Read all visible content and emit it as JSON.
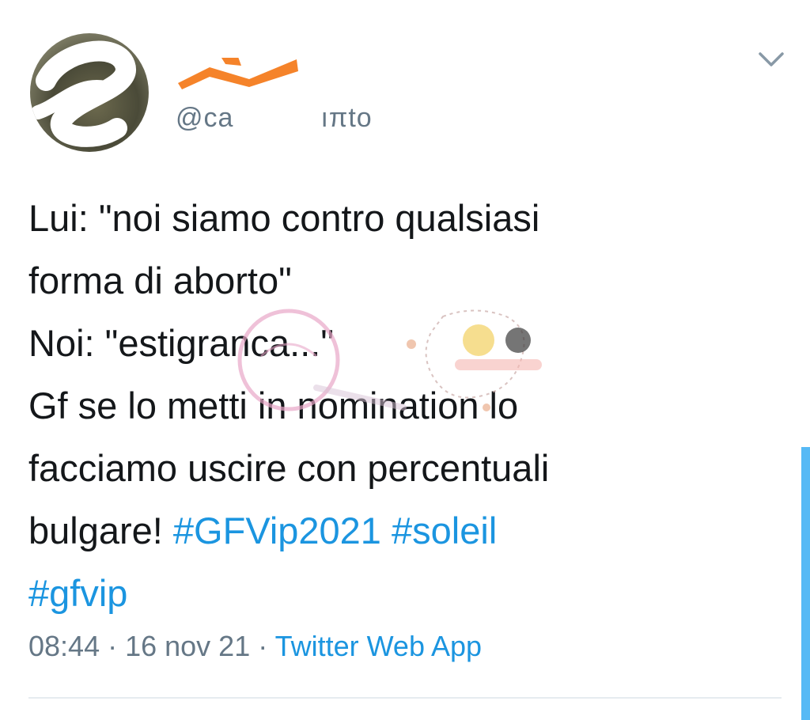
{
  "tweet": {
    "handle_start": "@ca",
    "handle_end": "ıπto",
    "text_lines": [
      "Lui: \"noi siamo contro qualsiasi",
      "forma di aborto\"",
      "Noi: \"estigranca...\"",
      "Gf se lo metti in nomination lo",
      "facciamo uscire con percentuali"
    ],
    "last_line_text": "bulgare! ",
    "hashtags": [
      "#GFVip2021",
      "#soleil",
      "#gfvip"
    ],
    "time": "08:44",
    "separator": " · ",
    "date": "16 nov 21",
    "source": "Twitter Web App"
  },
  "icons": {
    "menu": "chevron-down-icon",
    "avatar": "avatar-image"
  },
  "colors": {
    "hashtag": "#1b95e0",
    "meta": "#657786",
    "redaction_orange": "#f5832a",
    "text": "#14171a"
  }
}
